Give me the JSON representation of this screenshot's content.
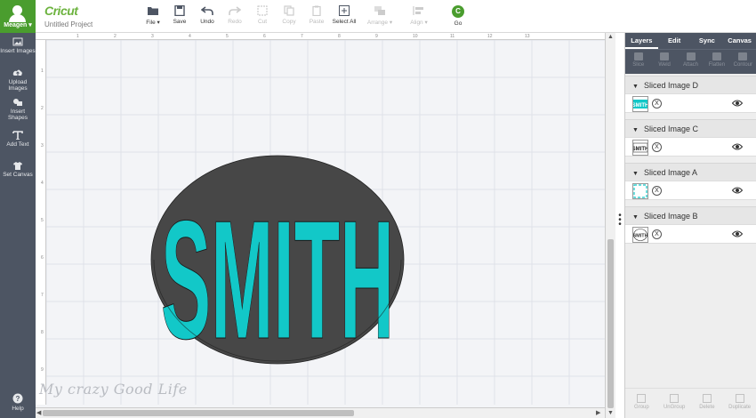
{
  "account": {
    "name": "Meagen"
  },
  "sidebar": {
    "items": [
      {
        "label": "Insert Images",
        "icon": "image-icon"
      },
      {
        "label": "Upload Images",
        "icon": "cloud-upload-icon"
      },
      {
        "label": "Insert Shapes",
        "icon": "shapes-icon"
      },
      {
        "label": "Add Text",
        "icon": "text-icon"
      },
      {
        "label": "Set Canvas",
        "icon": "shirt-icon"
      }
    ],
    "help": "Help"
  },
  "topbar": {
    "logo": "Cricut",
    "project_title": "Untitled Project",
    "tools": [
      {
        "label": "File",
        "icon": "folder-icon",
        "enabled": true,
        "dropdown": true
      },
      {
        "label": "Save",
        "icon": "save-icon",
        "enabled": true
      },
      {
        "label": "Undo",
        "icon": "undo-icon",
        "enabled": true
      },
      {
        "label": "Redo",
        "icon": "redo-icon",
        "enabled": false
      },
      {
        "label": "Cut",
        "icon": "cut-icon",
        "enabled": false
      },
      {
        "label": "Copy",
        "icon": "copy-icon",
        "enabled": false
      },
      {
        "label": "Paste",
        "icon": "paste-icon",
        "enabled": false
      },
      {
        "label": "Select All",
        "icon": "select-all-icon",
        "enabled": true
      },
      {
        "label": "Arrange",
        "icon": "arrange-icon",
        "enabled": false,
        "dropdown": true
      },
      {
        "label": "Align",
        "icon": "align-icon",
        "enabled": false,
        "dropdown": true
      }
    ],
    "go": {
      "label": "Go",
      "badge": "C"
    }
  },
  "canvas": {
    "ruler_top": [
      "1",
      "2",
      "3",
      "4",
      "5",
      "6",
      "7",
      "8",
      "9",
      "10",
      "11",
      "12",
      "13"
    ],
    "ruler_left": [
      "1",
      "2",
      "3",
      "4",
      "5",
      "6",
      "7",
      "8",
      "9"
    ],
    "design_text": "SMITH",
    "watermark": "My crazy Good Life",
    "colors": {
      "ellipse": "#474747",
      "letters": "#12c8c8",
      "grid": "#dfe2e8"
    }
  },
  "panel": {
    "tabs": [
      "Layers",
      "Edit",
      "Sync",
      "Canvas"
    ],
    "ops": [
      "Slice",
      "Weld",
      "Attach",
      "Flatten",
      "Contour"
    ],
    "layers": [
      {
        "name": "Sliced Image D"
      },
      {
        "name": "Sliced Image C"
      },
      {
        "name": "Sliced Image A"
      },
      {
        "name": "Sliced Image B"
      }
    ],
    "bottom_ops": [
      "Group",
      "UnGroup",
      "Delete",
      "Duplicate"
    ]
  }
}
